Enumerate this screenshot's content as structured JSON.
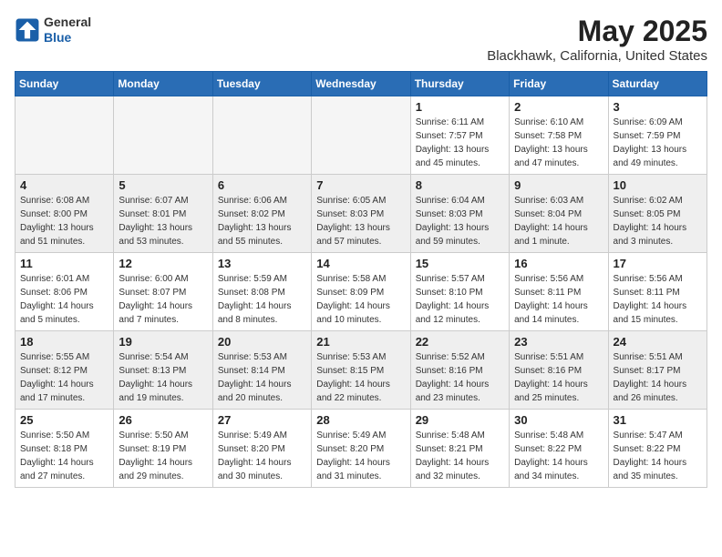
{
  "header": {
    "logo_general": "General",
    "logo_blue": "Blue",
    "month_title": "May 2025",
    "location": "Blackhawk, California, United States"
  },
  "days_of_week": [
    "Sunday",
    "Monday",
    "Tuesday",
    "Wednesday",
    "Thursday",
    "Friday",
    "Saturday"
  ],
  "weeks": [
    [
      {
        "day": "",
        "empty": true
      },
      {
        "day": "",
        "empty": true
      },
      {
        "day": "",
        "empty": true
      },
      {
        "day": "",
        "empty": true
      },
      {
        "day": "1",
        "sunrise": "6:11 AM",
        "sunset": "7:57 PM",
        "daylight": "13 hours and 45 minutes."
      },
      {
        "day": "2",
        "sunrise": "6:10 AM",
        "sunset": "7:58 PM",
        "daylight": "13 hours and 47 minutes."
      },
      {
        "day": "3",
        "sunrise": "6:09 AM",
        "sunset": "7:59 PM",
        "daylight": "13 hours and 49 minutes."
      }
    ],
    [
      {
        "day": "4",
        "sunrise": "6:08 AM",
        "sunset": "8:00 PM",
        "daylight": "13 hours and 51 minutes."
      },
      {
        "day": "5",
        "sunrise": "6:07 AM",
        "sunset": "8:01 PM",
        "daylight": "13 hours and 53 minutes."
      },
      {
        "day": "6",
        "sunrise": "6:06 AM",
        "sunset": "8:02 PM",
        "daylight": "13 hours and 55 minutes."
      },
      {
        "day": "7",
        "sunrise": "6:05 AM",
        "sunset": "8:03 PM",
        "daylight": "13 hours and 57 minutes."
      },
      {
        "day": "8",
        "sunrise": "6:04 AM",
        "sunset": "8:03 PM",
        "daylight": "13 hours and 59 minutes."
      },
      {
        "day": "9",
        "sunrise": "6:03 AM",
        "sunset": "8:04 PM",
        "daylight": "14 hours and 1 minute."
      },
      {
        "day": "10",
        "sunrise": "6:02 AM",
        "sunset": "8:05 PM",
        "daylight": "14 hours and 3 minutes."
      }
    ],
    [
      {
        "day": "11",
        "sunrise": "6:01 AM",
        "sunset": "8:06 PM",
        "daylight": "14 hours and 5 minutes."
      },
      {
        "day": "12",
        "sunrise": "6:00 AM",
        "sunset": "8:07 PM",
        "daylight": "14 hours and 7 minutes."
      },
      {
        "day": "13",
        "sunrise": "5:59 AM",
        "sunset": "8:08 PM",
        "daylight": "14 hours and 8 minutes."
      },
      {
        "day": "14",
        "sunrise": "5:58 AM",
        "sunset": "8:09 PM",
        "daylight": "14 hours and 10 minutes."
      },
      {
        "day": "15",
        "sunrise": "5:57 AM",
        "sunset": "8:10 PM",
        "daylight": "14 hours and 12 minutes."
      },
      {
        "day": "16",
        "sunrise": "5:56 AM",
        "sunset": "8:11 PM",
        "daylight": "14 hours and 14 minutes."
      },
      {
        "day": "17",
        "sunrise": "5:56 AM",
        "sunset": "8:11 PM",
        "daylight": "14 hours and 15 minutes."
      }
    ],
    [
      {
        "day": "18",
        "sunrise": "5:55 AM",
        "sunset": "8:12 PM",
        "daylight": "14 hours and 17 minutes."
      },
      {
        "day": "19",
        "sunrise": "5:54 AM",
        "sunset": "8:13 PM",
        "daylight": "14 hours and 19 minutes."
      },
      {
        "day": "20",
        "sunrise": "5:53 AM",
        "sunset": "8:14 PM",
        "daylight": "14 hours and 20 minutes."
      },
      {
        "day": "21",
        "sunrise": "5:53 AM",
        "sunset": "8:15 PM",
        "daylight": "14 hours and 22 minutes."
      },
      {
        "day": "22",
        "sunrise": "5:52 AM",
        "sunset": "8:16 PM",
        "daylight": "14 hours and 23 minutes."
      },
      {
        "day": "23",
        "sunrise": "5:51 AM",
        "sunset": "8:16 PM",
        "daylight": "14 hours and 25 minutes."
      },
      {
        "day": "24",
        "sunrise": "5:51 AM",
        "sunset": "8:17 PM",
        "daylight": "14 hours and 26 minutes."
      }
    ],
    [
      {
        "day": "25",
        "sunrise": "5:50 AM",
        "sunset": "8:18 PM",
        "daylight": "14 hours and 27 minutes."
      },
      {
        "day": "26",
        "sunrise": "5:50 AM",
        "sunset": "8:19 PM",
        "daylight": "14 hours and 29 minutes."
      },
      {
        "day": "27",
        "sunrise": "5:49 AM",
        "sunset": "8:20 PM",
        "daylight": "14 hours and 30 minutes."
      },
      {
        "day": "28",
        "sunrise": "5:49 AM",
        "sunset": "8:20 PM",
        "daylight": "14 hours and 31 minutes."
      },
      {
        "day": "29",
        "sunrise": "5:48 AM",
        "sunset": "8:21 PM",
        "daylight": "14 hours and 32 minutes."
      },
      {
        "day": "30",
        "sunrise": "5:48 AM",
        "sunset": "8:22 PM",
        "daylight": "14 hours and 34 minutes."
      },
      {
        "day": "31",
        "sunrise": "5:47 AM",
        "sunset": "8:22 PM",
        "daylight": "14 hours and 35 minutes."
      }
    ]
  ]
}
